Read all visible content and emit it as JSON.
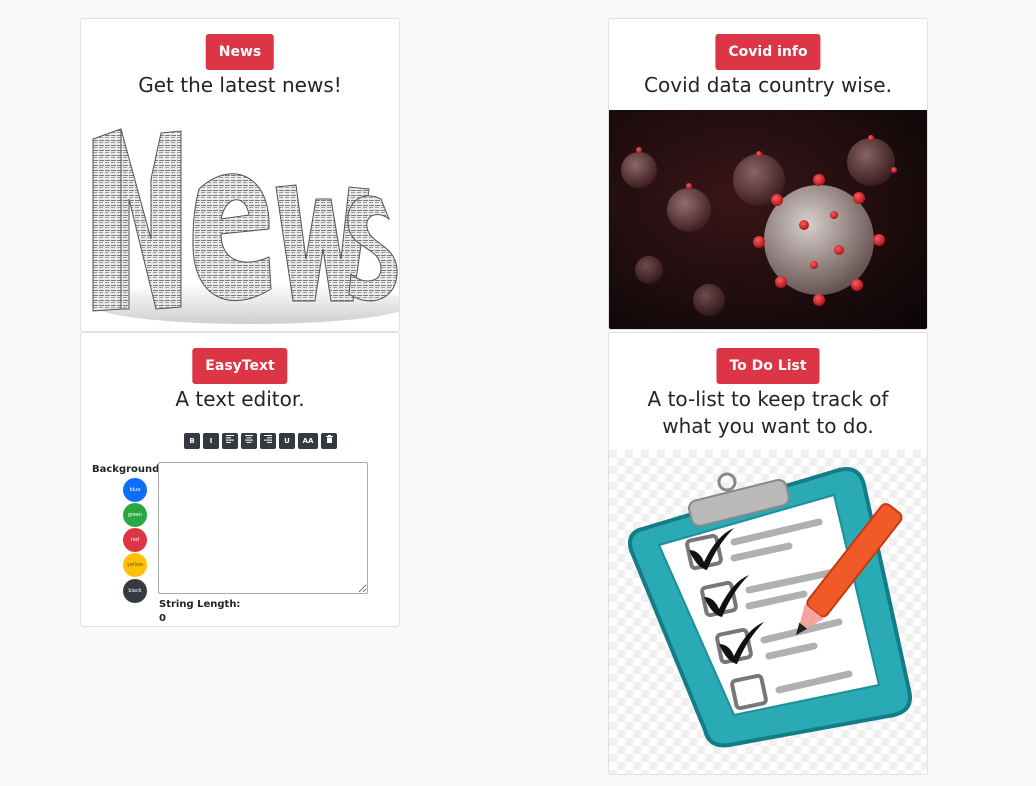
{
  "cards": [
    {
      "button": "News",
      "subtitle": "Get the latest news!",
      "image_alt": "NEWS"
    },
    {
      "button": "Covid info",
      "subtitle": "Covid data country wise.",
      "image_alt": "coronavirus"
    },
    {
      "button": "EasyText",
      "subtitle": "A text editor.",
      "editor": {
        "toolbar": [
          "B",
          "I",
          "",
          "",
          "",
          "U",
          "AA",
          ""
        ],
        "toolbar_icons": [
          "bold-icon",
          "italic-icon",
          "align-left-icon",
          "align-center-icon",
          "align-right-icon",
          "underline-icon",
          "font-size-icon",
          "trash-icon"
        ],
        "background_label": "Background",
        "colors": [
          {
            "name": "blue",
            "hex": "#0d6efd"
          },
          {
            "name": "green",
            "hex": "#28a745"
          },
          {
            "name": "red",
            "hex": "#dc3545"
          },
          {
            "name": "yellow",
            "hex": "#ffc107"
          },
          {
            "name": "black",
            "hex": "#343a40"
          }
        ],
        "textarea_value": "",
        "string_length_label": "String Length:",
        "string_length_value": "0"
      }
    },
    {
      "button": "To Do List",
      "subtitle_line1": "A to-list to keep track of",
      "subtitle_line2": "what you want to do.",
      "image_alt": "checklist"
    }
  ],
  "colors": {
    "accent": "#dc3545",
    "page_bg": "#f8f9fa",
    "toolbar_bg": "#343a40"
  }
}
